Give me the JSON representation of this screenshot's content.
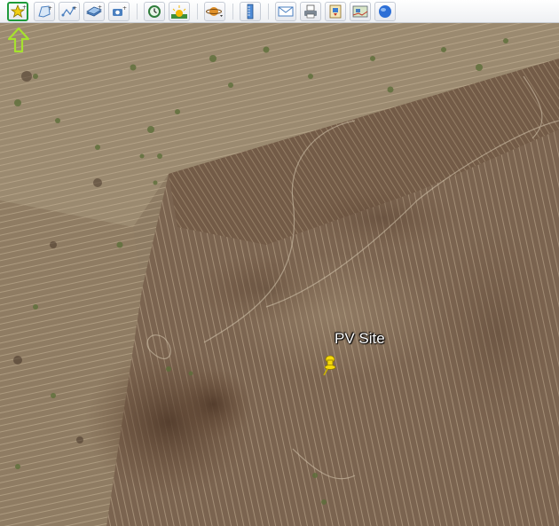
{
  "toolbar": {
    "buttons": [
      {
        "name": "add-placemark",
        "icon": "pushpin-star-icon",
        "active": true
      },
      {
        "name": "add-polygon",
        "icon": "polygon-icon"
      },
      {
        "name": "add-path",
        "icon": "path-icon"
      },
      {
        "name": "add-image-overlay",
        "icon": "image-overlay-icon"
      },
      {
        "name": "record-tour",
        "icon": "camera-record-icon"
      },
      {
        "name": "historical-imagery",
        "icon": "clock-history-icon"
      },
      {
        "name": "sunlight",
        "icon": "sunlight-icon"
      },
      {
        "name": "switch-planet",
        "icon": "planet-icon"
      },
      {
        "name": "ruler",
        "icon": "ruler-icon"
      },
      {
        "name": "email",
        "icon": "email-icon"
      },
      {
        "name": "print",
        "icon": "print-icon"
      },
      {
        "name": "save-image",
        "icon": "save-image-icon"
      },
      {
        "name": "view-in-maps",
        "icon": "map-view-icon"
      },
      {
        "name": "earth-gallery",
        "icon": "globe-icon"
      }
    ]
  },
  "map": {
    "placemark": {
      "label": "PV Site",
      "icon": "yellow-pushpin-icon",
      "color": "#f5d90a"
    }
  },
  "colors": {
    "highlight": "#1f9a3a",
    "hint_arrow": "#a6e22e"
  }
}
